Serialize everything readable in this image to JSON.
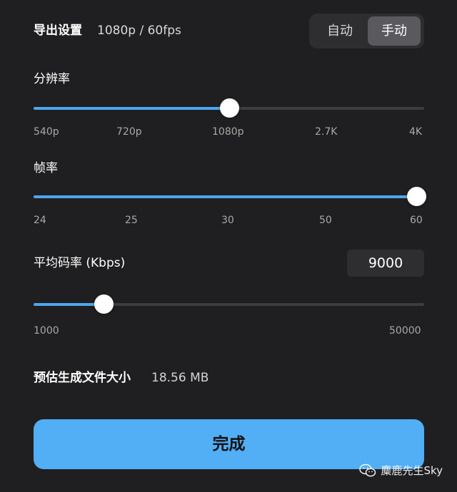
{
  "header": {
    "title": "导出设置",
    "summary": "1080p / 60fps",
    "modes": {
      "auto": "自动",
      "manual": "手动",
      "selected": "manual"
    }
  },
  "resolution": {
    "label": "分辨率",
    "ticks": [
      "540p",
      "720p",
      "1080p",
      "2.7K",
      "4K"
    ],
    "selected": "1080p",
    "value_fraction": 0.5
  },
  "framerate": {
    "label": "帧率",
    "ticks": [
      "24",
      "25",
      "30",
      "50",
      "60"
    ],
    "selected": "60",
    "value_fraction": 1.0
  },
  "bitrate": {
    "label": "平均码率 (Kbps)",
    "value": "9000",
    "min_label": "1000",
    "max_label": "50000",
    "value_fraction": 0.18
  },
  "estimate": {
    "label": "预估生成文件大小",
    "value": "18.56 MB"
  },
  "done_button": {
    "label": "完成"
  },
  "watermark": {
    "text": "麋鹿先生Sky",
    "icon": "wechat-icon"
  },
  "colors": {
    "background": "#1f1f21",
    "accent": "#4da6ee",
    "button": "#52aef5"
  }
}
